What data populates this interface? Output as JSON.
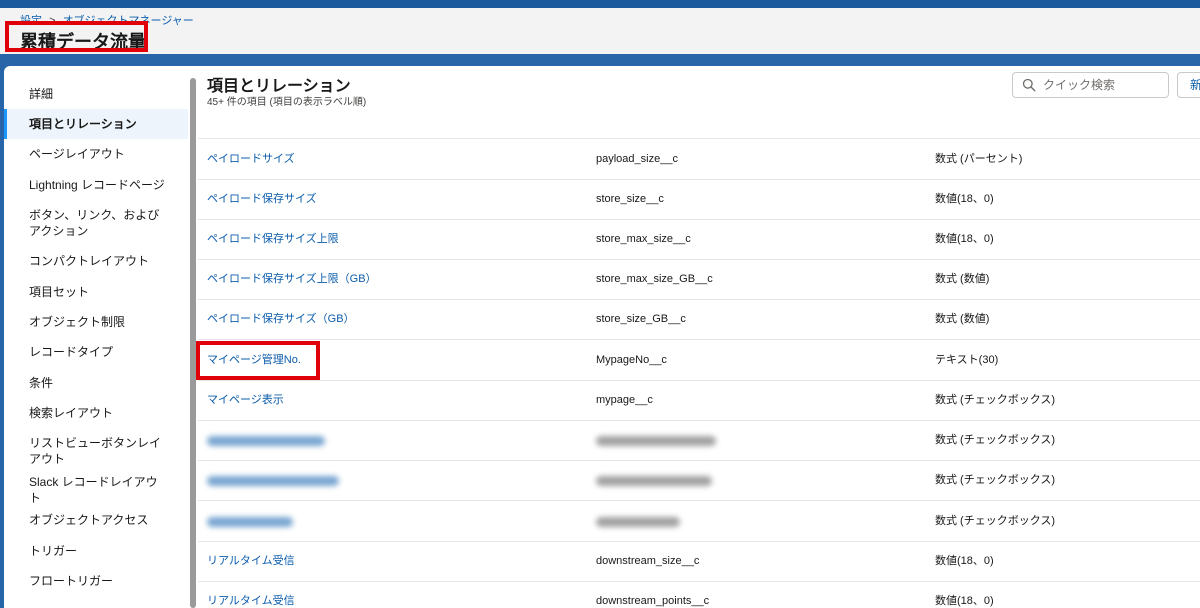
{
  "header": {
    "breadcrumb": [
      "設定",
      "オブジェクトマネージャー"
    ],
    "breadcrumb_separator": ">",
    "title": "累積データ流量"
  },
  "sidebar": {
    "items": [
      {
        "label": "詳細"
      },
      {
        "label": "項目とリレーション",
        "active": true
      },
      {
        "label": "ページレイアウト"
      },
      {
        "label": "Lightning レコードページ"
      },
      {
        "label": "ボタン、リンク、およびアクション"
      },
      {
        "label": "コンパクトレイアウト"
      },
      {
        "label": "項目セット"
      },
      {
        "label": "オブジェクト制限"
      },
      {
        "label": "レコードタイプ"
      },
      {
        "label": "条件"
      },
      {
        "label": "検索レイアウト"
      },
      {
        "label": "リストビューボタンレイアウト"
      },
      {
        "label": "Slack レコードレイアウト"
      },
      {
        "label": "オブジェクトアクセス"
      },
      {
        "label": "トリガー"
      },
      {
        "label": "フロートリガー"
      }
    ]
  },
  "main": {
    "title": "項目とリレーション",
    "subtitle": "45+ 件の項目 (項目の表示ラベル順)",
    "search": {
      "placeholder": "クイック検索",
      "icon": "search-icon"
    },
    "new_button_label": "新"
  },
  "table": {
    "rows": [
      {
        "label": "ペイロードサイズ",
        "api": "payload_size__c",
        "type": "数式 (パーセント)"
      },
      {
        "label": "ペイロード保存サイズ",
        "api": "store_size__c",
        "type": "数値(18、0)"
      },
      {
        "label": "ペイロード保存サイズ上限",
        "api": "store_max_size__c",
        "type": "数値(18、0)"
      },
      {
        "label": "ペイロード保存サイズ上限（GB）",
        "api": "store_max_size_GB__c",
        "type": "数式 (数値)"
      },
      {
        "label": "ペイロード保存サイズ（GB）",
        "api": "store_size_GB__c",
        "type": "数式 (数値)"
      },
      {
        "label": "マイページ管理No.",
        "api": "MypageNo__c",
        "type": "テキスト(30)",
        "highlighted": true
      },
      {
        "label": "マイページ表示",
        "api": "mypage__c",
        "type": "数式 (チェックボックス)"
      },
      {
        "label": "",
        "api": "",
        "type": "数式 (チェックボックス)",
        "blurred": true
      },
      {
        "label": "",
        "api": "",
        "type": "数式 (チェックボックス)",
        "blurred": true
      },
      {
        "label": "",
        "api": "",
        "type": "数式 (チェックボックス)",
        "blurred": true
      },
      {
        "label": "リアルタイム受信",
        "api": "downstream_size__c",
        "type": "数値(18、0)"
      },
      {
        "label": "リアルタイム受信",
        "api": "downstream_points__c",
        "type": "数値(18、0)"
      }
    ]
  },
  "colors": {
    "link": "#0b5cab",
    "highlight": "#e0000a",
    "brand_band": "#1f5da3",
    "active_indicator": "#1b96ff"
  }
}
